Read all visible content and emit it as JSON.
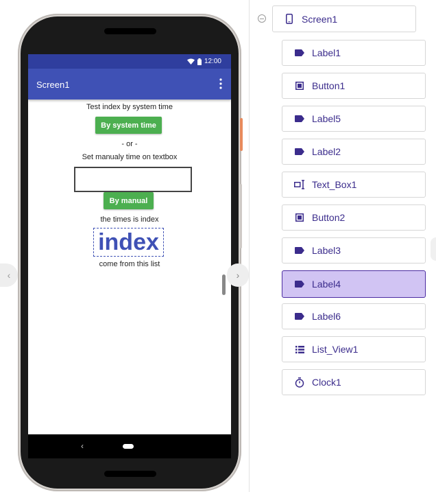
{
  "phone": {
    "status_time": "12:00",
    "app_title": "Screen1",
    "labels": {
      "label1": "Test index by system time",
      "label5": "- or -",
      "label2": "Set manualy time on textbox",
      "label3": "the times is index",
      "label4": "index",
      "label6": "come from this list"
    },
    "buttons": {
      "button1": "By system time",
      "button2": "By manual"
    },
    "textbox_value": "",
    "nav_back_glyph": "‹",
    "pager_left_glyph": "‹",
    "pager_right_glyph": "›"
  },
  "tree": {
    "root": {
      "label": "Screen1",
      "icon": "phone-icon"
    },
    "items": [
      {
        "label": "Label1",
        "icon": "label-tag-icon",
        "selected": false
      },
      {
        "label": "Button1",
        "icon": "button-icon",
        "selected": false
      },
      {
        "label": "Label5",
        "icon": "label-tag-icon",
        "selected": false
      },
      {
        "label": "Label2",
        "icon": "label-tag-icon",
        "selected": false
      },
      {
        "label": "Text_Box1",
        "icon": "textbox-icon",
        "selected": false
      },
      {
        "label": "Button2",
        "icon": "button-icon",
        "selected": false
      },
      {
        "label": "Label3",
        "icon": "label-tag-icon",
        "selected": false
      },
      {
        "label": "Label4",
        "icon": "label-tag-icon",
        "selected": true
      },
      {
        "label": "Label6",
        "icon": "label-tag-icon",
        "selected": false
      },
      {
        "label": "List_View1",
        "icon": "list-icon",
        "selected": false
      },
      {
        "label": "Clock1",
        "icon": "clock-icon",
        "selected": false
      }
    ]
  },
  "colors": {
    "status_bar": "#2f3e9e",
    "app_bar": "#3f51b5",
    "button_green": "#4caf50",
    "tree_text": "#3b2c8c",
    "selected_bg": "#d1c4f3"
  }
}
